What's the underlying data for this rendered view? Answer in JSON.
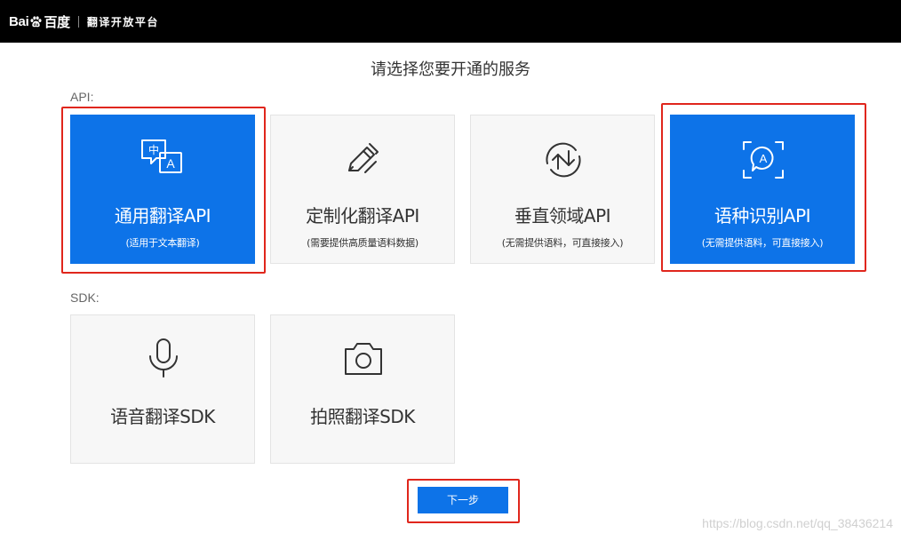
{
  "header": {
    "logo_text_left": "Bai",
    "logo_text_right": "百度",
    "platform_name": "翻译开放平台"
  },
  "page_title": "请选择您要开通的服务",
  "sections": {
    "api_label": "API:",
    "sdk_label": "SDK:"
  },
  "api_cards": [
    {
      "title": "通用翻译API",
      "subtitle": "(适用于文本翻译)",
      "icon": "translate-zh-a-icon",
      "selected": true
    },
    {
      "title": "定制化翻译API",
      "subtitle": "(需要提供高质量语料数据)",
      "icon": "pen-edit-icon",
      "selected": false
    },
    {
      "title": "垂直领域API",
      "subtitle": "(无需提供语料，可直接接入)",
      "icon": "sync-arrows-icon",
      "selected": false
    },
    {
      "title": "语种识别API",
      "subtitle": "(无需提供语料，可直接接入)",
      "icon": "language-detect-icon",
      "selected": true
    }
  ],
  "sdk_cards": [
    {
      "title": "语音翻译SDK",
      "icon": "microphone-icon",
      "selected": false
    },
    {
      "title": "拍照翻译SDK",
      "icon": "camera-icon",
      "selected": false
    }
  ],
  "next_button": "下一步",
  "watermark": "https://blog.csdn.net/qq_38436214",
  "colors": {
    "selected_blue": "#0d73e8",
    "highlight_red": "#e0261c",
    "topbar_black": "#000000",
    "card_bg": "#f7f7f7"
  }
}
